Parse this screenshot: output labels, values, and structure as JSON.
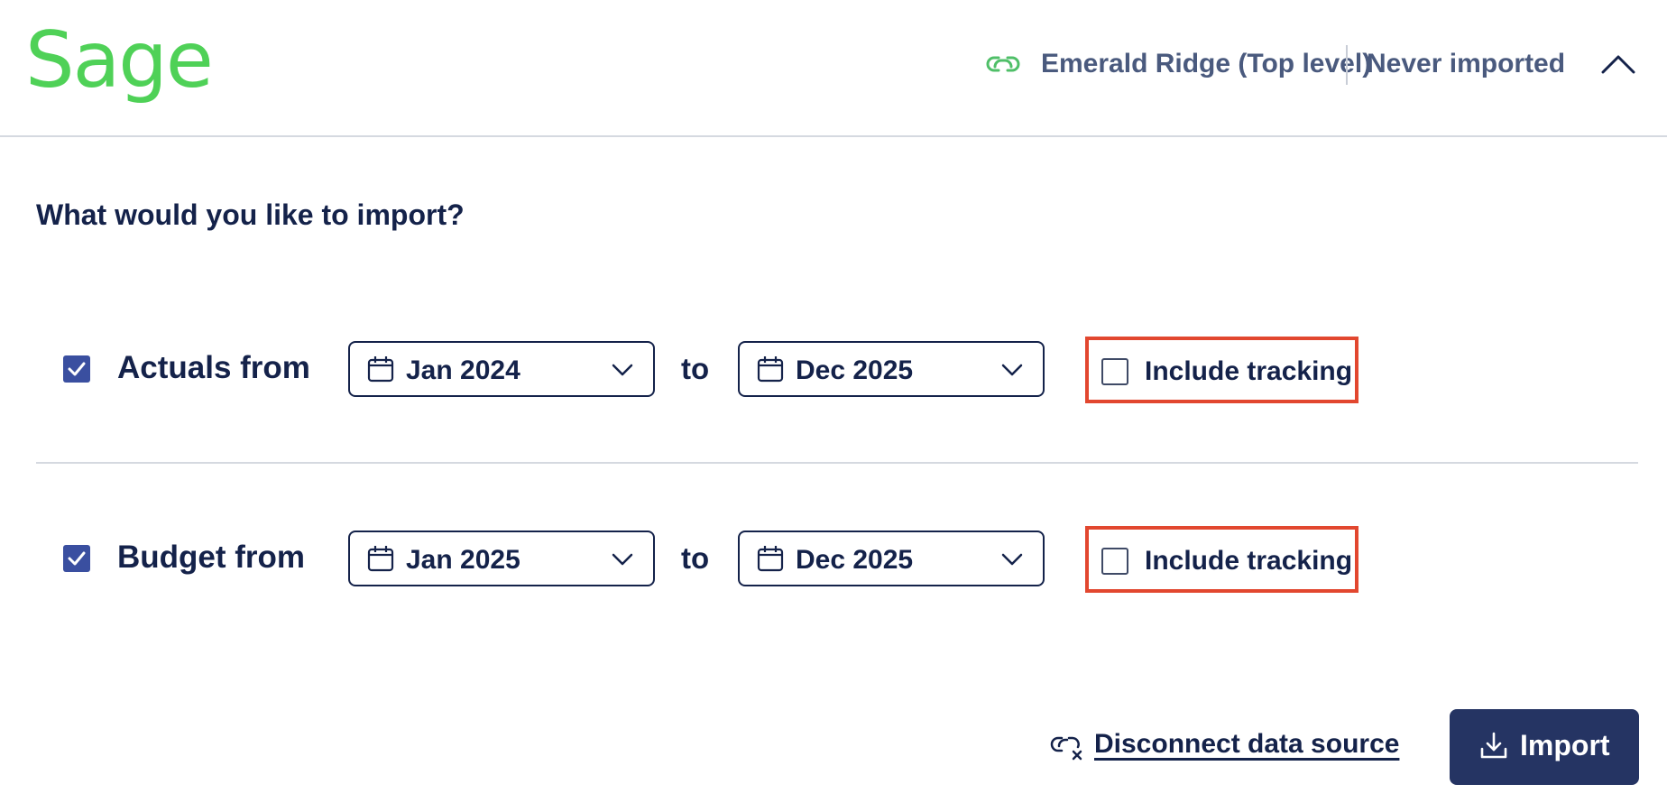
{
  "header": {
    "logo_text": "Sage",
    "organization": "Emerald Ridge (Top level)",
    "import_status": "Never imported",
    "brand_color": "#4fd157"
  },
  "main": {
    "question": "What would you like to import?",
    "rows": [
      {
        "label": "Actuals from",
        "checked": true,
        "from": "Jan 2024",
        "to_label": "to",
        "to": "Dec 2025",
        "tracking_label": "Include tracking",
        "tracking_checked": false
      },
      {
        "label": "Budget from",
        "checked": true,
        "from": "Jan 2025",
        "to_label": "to",
        "to": "Dec 2025",
        "tracking_label": "Include tracking",
        "tracking_checked": false
      }
    ]
  },
  "footer": {
    "disconnect_label": "Disconnect data source",
    "import_label": "Import"
  },
  "colors": {
    "primary": "#253463",
    "checkbox": "#3a4fa0",
    "highlight": "#e2472f",
    "text": "#14224a"
  }
}
